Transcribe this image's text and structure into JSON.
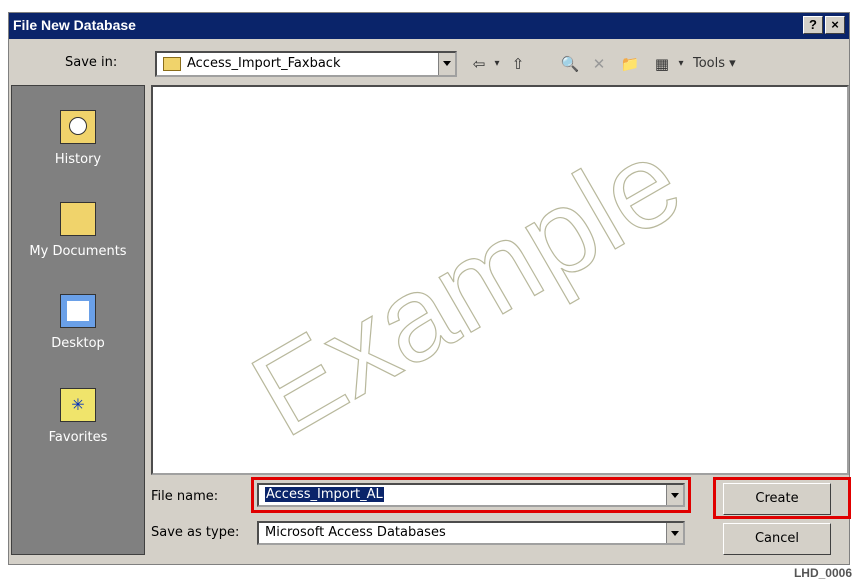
{
  "window": {
    "title": "File New Database",
    "help_label": "?",
    "close_label": "×"
  },
  "save_in": {
    "label": "Save in:",
    "folder": "Access_Import_Faxback"
  },
  "toolbar": {
    "tools_label": "Tools ▾"
  },
  "places": [
    {
      "label": "History"
    },
    {
      "label": "My Documents"
    },
    {
      "label": "Desktop"
    },
    {
      "label": "Favorites"
    }
  ],
  "file_pane": {
    "watermark": "Example"
  },
  "file_name": {
    "label": "File name:",
    "value": "Access_Import_AL"
  },
  "save_as_type": {
    "label": "Save as type:",
    "value": "Microsoft Access Databases"
  },
  "buttons": {
    "create": "Create",
    "cancel": "Cancel"
  },
  "footnote": "LHD_0006"
}
